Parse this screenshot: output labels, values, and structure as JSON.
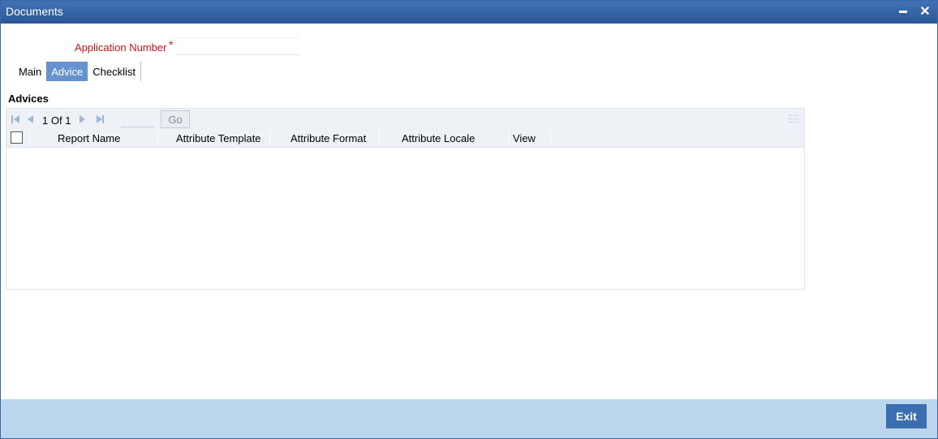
{
  "window": {
    "title": "Documents"
  },
  "form": {
    "app_number_label": "Application Number",
    "required_marker": "*",
    "app_number_value": ""
  },
  "tabs": [
    {
      "label": "Main",
      "active": false
    },
    {
      "label": "Advice",
      "active": true
    },
    {
      "label": "Checklist",
      "active": false
    }
  ],
  "advices": {
    "section_title": "Advices",
    "pagination": {
      "current": "1",
      "of_label": "Of",
      "total": "1",
      "go_label": "Go"
    },
    "columns": [
      "Report Name",
      "Attribute Template",
      "Attribute Format",
      "Attribute Locale",
      "View"
    ],
    "rows": []
  },
  "footer": {
    "exit_label": "Exit"
  },
  "colors": {
    "titlebar": "#2c5796",
    "active_tab": "#6693cf",
    "required": "#c8151b",
    "footer": "#bcd6ee",
    "exit_button": "#3b6fb0"
  }
}
